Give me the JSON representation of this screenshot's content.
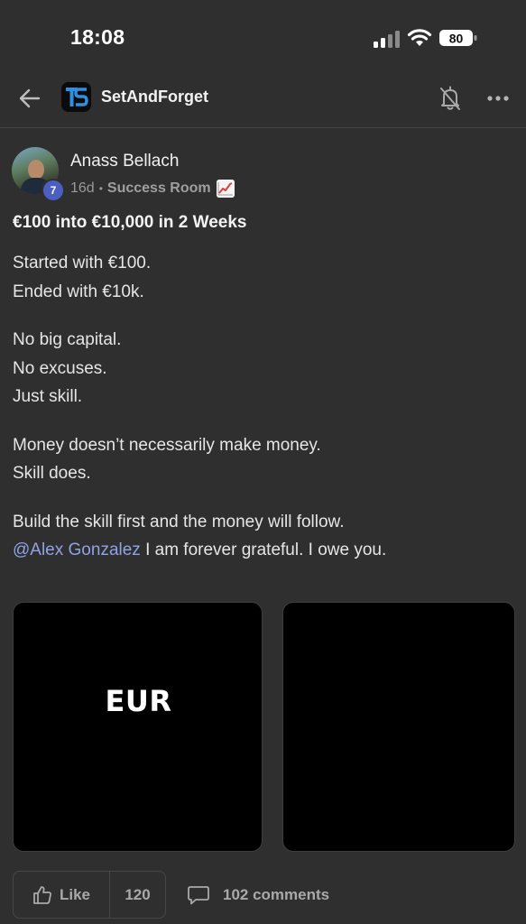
{
  "status_bar": {
    "time": "18:08",
    "battery_level": "80",
    "icons": [
      "cellular-signal-icon",
      "wifi-icon",
      "battery-icon"
    ]
  },
  "header": {
    "group_name": "SetAndForget",
    "icons": [
      "back-arrow-icon",
      "group-logo",
      "bell-muted-icon",
      "more-dots-icon"
    ]
  },
  "post": {
    "author": {
      "name": "Anass Bellach",
      "level": "7"
    },
    "meta": {
      "age": "16d",
      "separator": "•",
      "room": "Success Room"
    },
    "title": "€100 into €10,000 in 2 Weeks",
    "paragraphs": {
      "p1_l1": "Started with €100.",
      "p1_l2": "Ended with €10k.",
      "p2_l1": "No big capital.",
      "p2_l2": "No excuses.",
      "p2_l3": "Just skill.",
      "p3_l1": "Money doesn’t necessarily make money.",
      "p3_l2": "Skill does.",
      "p4_l1": "Build the skill first and the money will follow.",
      "p4_mention": "@Alex Gonzalez",
      "p4_l2_rest": " I am forever grateful. I owe you."
    },
    "media": [
      {
        "label": "EUR"
      },
      {
        "label": ""
      }
    ]
  },
  "actions": {
    "like_label": "Like",
    "like_count": "120",
    "comments_label": "102 comments"
  },
  "colors": {
    "background": "#2f2f2f",
    "mention": "#8fa3e6",
    "level_badge": "#4a5fc1",
    "logo_accent": "#2f8fe0"
  }
}
